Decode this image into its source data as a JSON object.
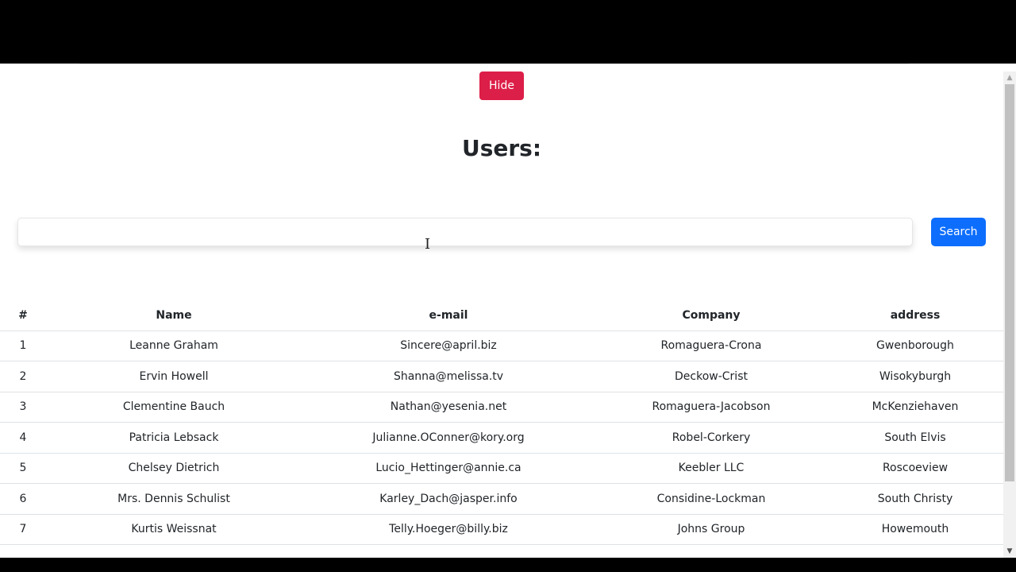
{
  "hide_button_label": "Hide",
  "page_title": "Users:",
  "search": {
    "value": "",
    "placeholder": "",
    "button_label": "Search"
  },
  "table": {
    "headers": [
      "#",
      "Name",
      "e-mail",
      "Company",
      "address"
    ],
    "rows": [
      {
        "num": "1",
        "name": "Leanne Graham",
        "email": "Sincere@april.biz",
        "company": "Romaguera-Crona",
        "address": "Gwenborough"
      },
      {
        "num": "2",
        "name": "Ervin Howell",
        "email": "Shanna@melissa.tv",
        "company": "Deckow-Crist",
        "address": "Wisokyburgh"
      },
      {
        "num": "3",
        "name": "Clementine Bauch",
        "email": "Nathan@yesenia.net",
        "company": "Romaguera-Jacobson",
        "address": "McKenziehaven"
      },
      {
        "num": "4",
        "name": "Patricia Lebsack",
        "email": "Julianne.OConner@kory.org",
        "company": "Robel-Corkery",
        "address": "South Elvis"
      },
      {
        "num": "5",
        "name": "Chelsey Dietrich",
        "email": "Lucio_Hettinger@annie.ca",
        "company": "Keebler LLC",
        "address": "Roscoeview"
      },
      {
        "num": "6",
        "name": "Mrs. Dennis Schulist",
        "email": "Karley_Dach@jasper.info",
        "company": "Considine-Lockman",
        "address": "South Christy"
      },
      {
        "num": "7",
        "name": "Kurtis Weissnat",
        "email": "Telly.Hoeger@billy.biz",
        "company": "Johns Group",
        "address": "Howemouth"
      }
    ]
  },
  "colors": {
    "hide_button": "#dc1f48",
    "search_button": "#0d6efd"
  },
  "icons": {
    "scroll_up": "triangle-up",
    "scroll_down": "triangle-down",
    "text_cursor": "i-beam"
  }
}
